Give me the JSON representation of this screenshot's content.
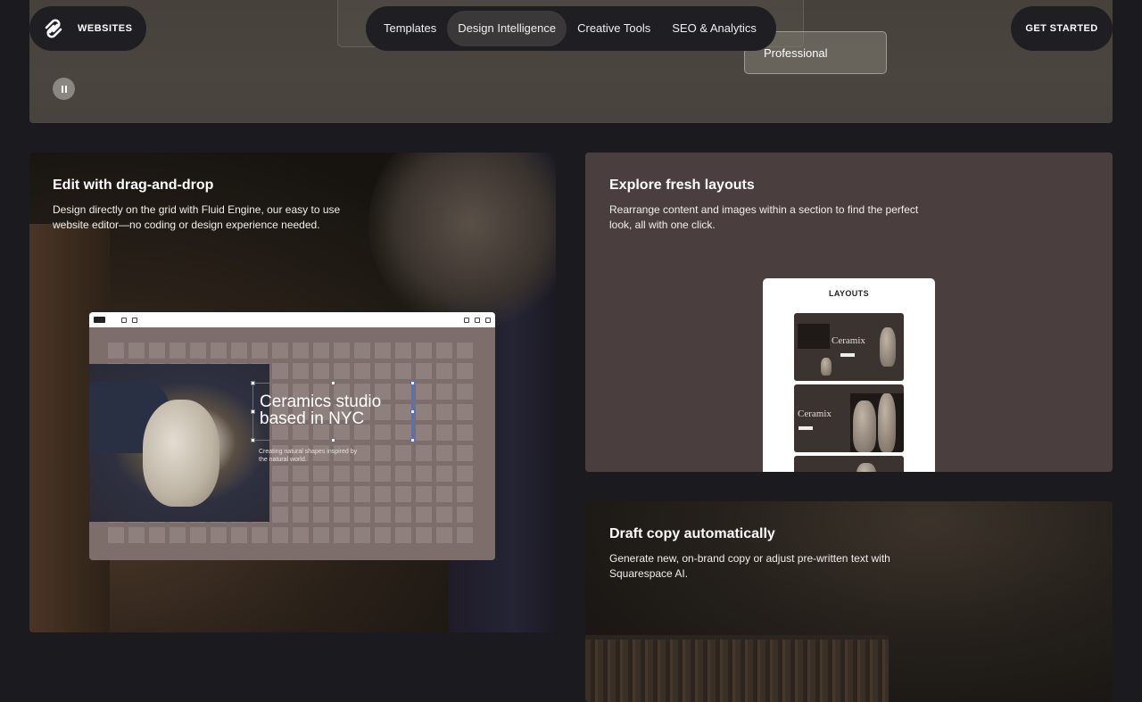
{
  "nav": {
    "brand_label": "WEBSITES",
    "tabs": [
      {
        "label": "Templates",
        "active": false
      },
      {
        "label": "Design Intelligence",
        "active": true
      },
      {
        "label": "Creative Tools",
        "active": false
      },
      {
        "label": "SEO & Analytics",
        "active": false
      }
    ],
    "cta_label": "GET STARTED"
  },
  "hero": {
    "chip_label": "Professional"
  },
  "cards": {
    "drag": {
      "title": "Edit with drag-and-drop",
      "body": "Design directly on the grid with Fluid Engine, our easy to use website editor—no coding or design experience needed.",
      "editor": {
        "headline_line1": "Ceramics studio",
        "headline_line2": "based in NYC",
        "subtext": "Creating natural shapes inspired by the natural world."
      }
    },
    "layouts": {
      "title": "Explore fresh layouts",
      "body": "Rearrange content and images within a section to find the perfect look, all with one click.",
      "panel_title": "LAYOUTS",
      "thumb_word": "Ceramix"
    },
    "draft": {
      "title": "Draft copy automatically",
      "body": "Generate new, on-brand copy or adjust pre-written text with Squarespace AI."
    }
  },
  "colors": {
    "page_bg": "#1b1a1e",
    "pill_bg": "#1f1e22",
    "active_tab": "#3a3838",
    "selection_blue": "#4a6fe0",
    "layouts_card": "#4a3f3e"
  }
}
